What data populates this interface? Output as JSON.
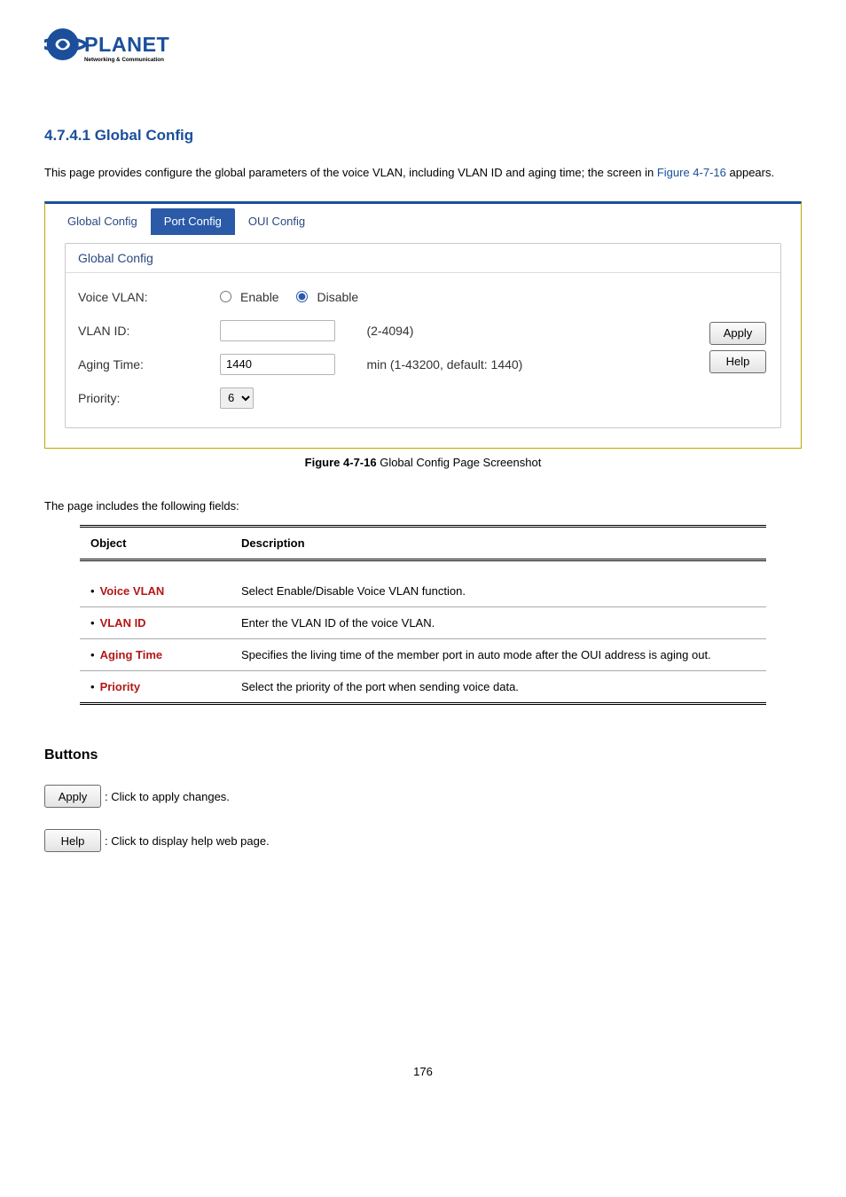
{
  "logo": {
    "brand": "PLANET",
    "tagline": "Networking & Communication"
  },
  "section_title": "4.7.4.1 Global Config",
  "intro_prefix": "This page provides configure the global parameters of the voice VLAN, including VLAN ID and aging time; the screen in ",
  "intro_figure": "Figure 4-7-16",
  "intro_suffix": " appears.",
  "tabs": {
    "t0": "Global Config",
    "t1": "Port Config",
    "t2": "OUI Config"
  },
  "panel_head": "Global Config",
  "form": {
    "voice_vlan_label": "Voice VLAN:",
    "enable_label": "Enable",
    "disable_label": "Disable",
    "vlan_id_label": "VLAN ID:",
    "vlan_id_hint": "(2-4094)",
    "vlan_id_value": "",
    "aging_label": "Aging Time:",
    "aging_value": "1440",
    "aging_hint": "min (1-43200, default: 1440)",
    "priority_label": "Priority:",
    "priority_value": "6"
  },
  "buttons": {
    "apply": "Apply",
    "help": "Help"
  },
  "caption_prefix": "Figure 4-7-16",
  "caption_suffix": " Global Config Page Screenshot",
  "fields_intro": "The page includes the following fields:",
  "table": {
    "head_object": "Object",
    "head_desc": "Description",
    "rows": [
      {
        "obj": "Voice VLAN",
        "desc": "Select Enable/Disable Voice VLAN function."
      },
      {
        "obj": "VLAN ID",
        "desc": "Enter the VLAN ID of the voice VLAN."
      },
      {
        "obj": "Aging Time",
        "desc": "Specifies the living time of the member port in auto mode after the OUI address is aging out."
      },
      {
        "obj": "Priority",
        "desc": "Select the priority of the port when sending voice data."
      }
    ]
  },
  "buttons_section_title": "Buttons",
  "apply_btn_label": "Apply",
  "apply_btn_text": ": Click to apply changes.",
  "help_btn_label": "Help",
  "help_btn_text": ": Click to display help web page.",
  "page_number": "176"
}
